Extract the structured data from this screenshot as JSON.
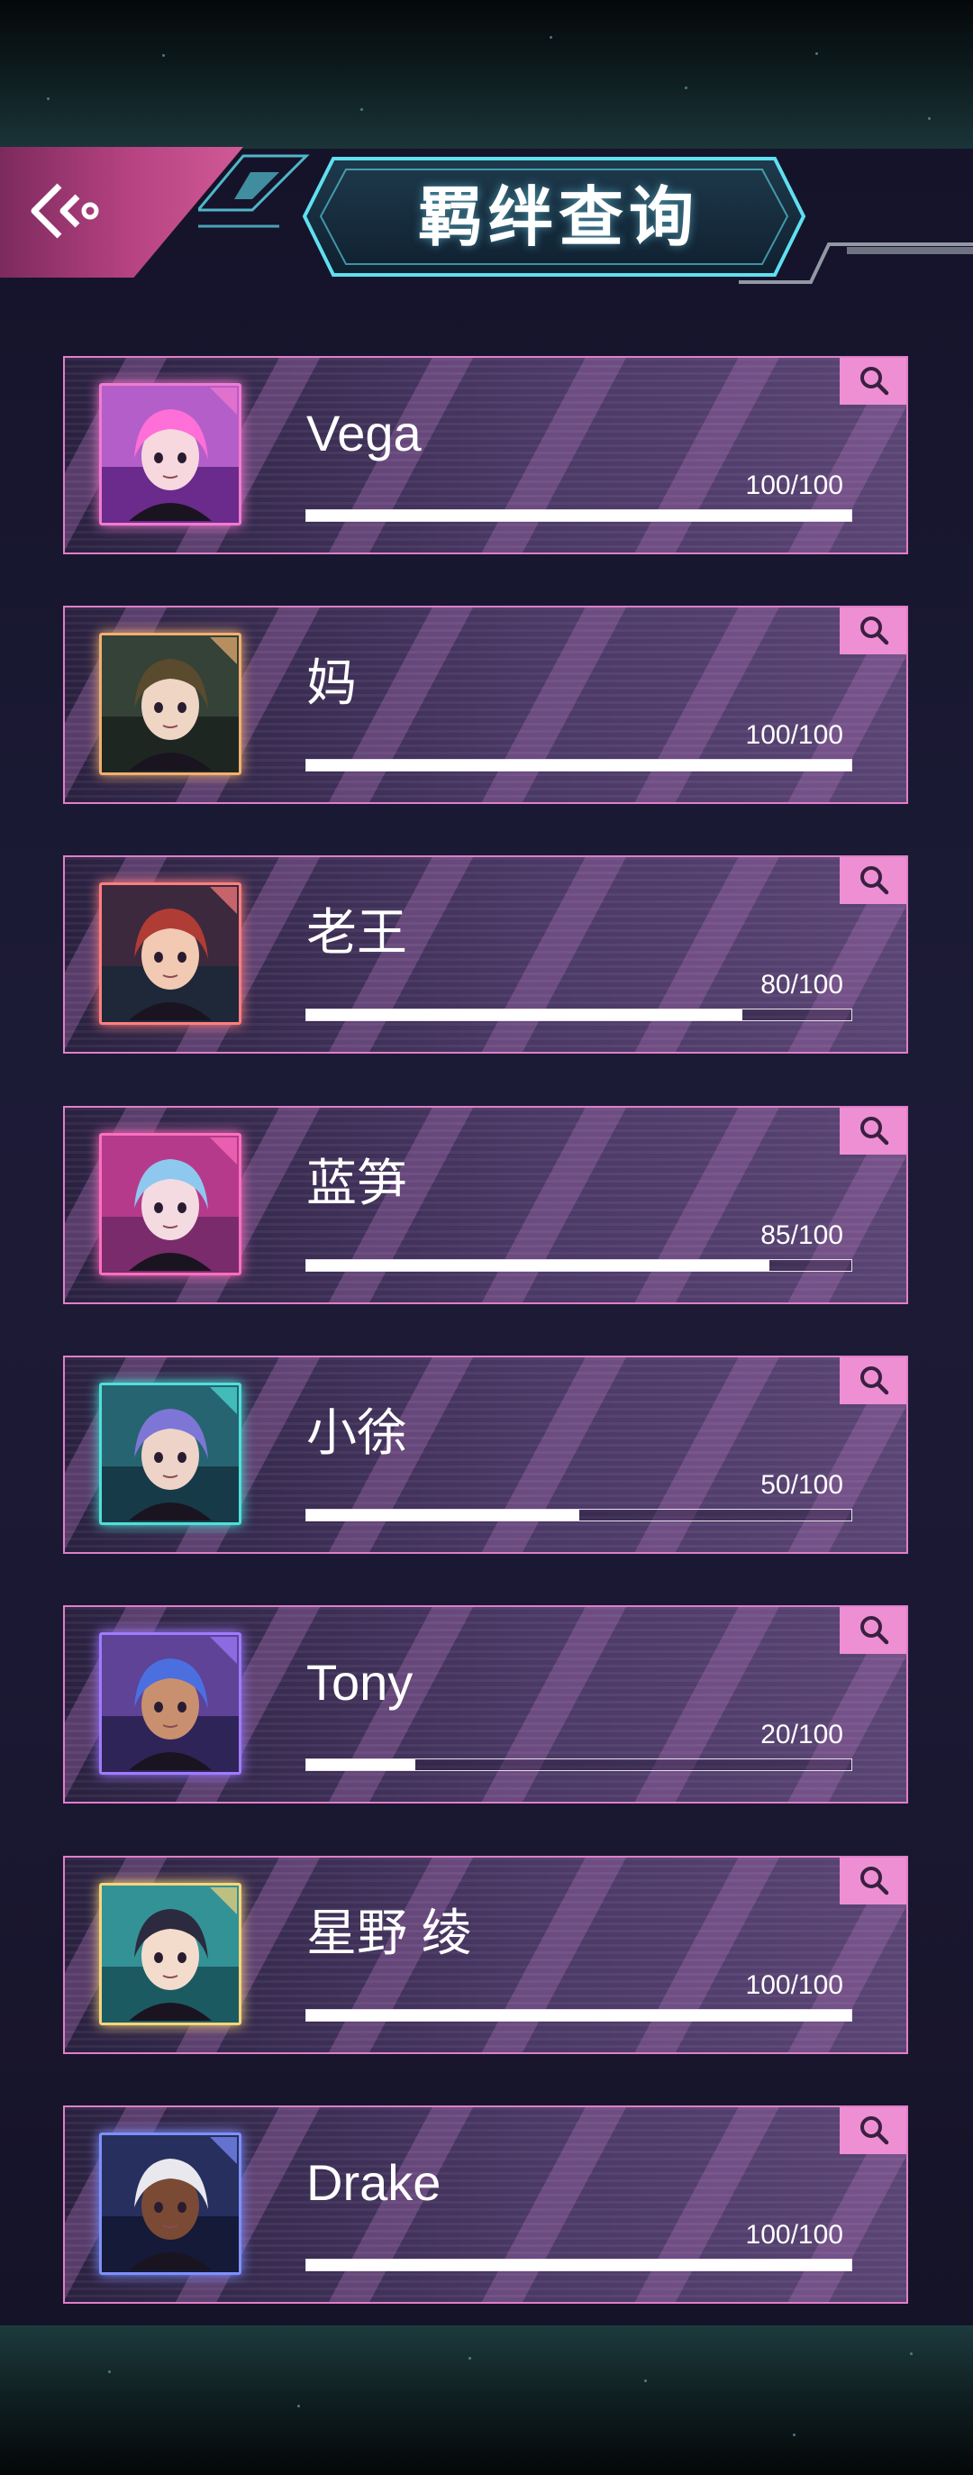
{
  "header": {
    "title": "羁绊查询"
  },
  "icons": {
    "back": "back-arrow-icon",
    "search": "magnifier-icon"
  },
  "colors": {
    "card_border": "#e07fc8",
    "search_button": "#ee8fd4",
    "title_glow": "#5fe0f0",
    "back_button": "#c04b8a"
  },
  "characters": [
    {
      "name": "Vega",
      "score": "100/100",
      "value": 100,
      "max": 100,
      "frame": "#f27ad0",
      "bg1": "#c76bd8",
      "bg2": "#6a2b8c",
      "hair": "#ff6fd8",
      "skin": "#f6d8de"
    },
    {
      "name": "妈",
      "score": "100/100",
      "value": 100,
      "max": 100,
      "frame": "#f0b070",
      "bg1": "#3a4a3e",
      "bg2": "#1e2622",
      "hair": "#5a4a2e",
      "skin": "#efd5c4"
    },
    {
      "name": "老王",
      "score": "80/100",
      "value": 80,
      "max": 100,
      "frame": "#ff7f7f",
      "bg1": "#43293e",
      "bg2": "#1e2838",
      "hair": "#b03c36",
      "skin": "#f2c9b2"
    },
    {
      "name": "蓝笋",
      "score": "85/100",
      "value": 85,
      "max": 100,
      "frame": "#ff6fbf",
      "bg1": "#c53f93",
      "bg2": "#7a2b6c",
      "hair": "#8ec8ee",
      "skin": "#f4dbe2"
    },
    {
      "name": "小徐",
      "score": "50/100",
      "value": 50,
      "max": 100,
      "frame": "#4fe0d8",
      "bg1": "#2c6f7c",
      "bg2": "#173a48",
      "hair": "#7e76d6",
      "skin": "#eed3c8"
    },
    {
      "name": "Tony",
      "score": "20/100",
      "value": 20,
      "max": 100,
      "frame": "#9f7bff",
      "bg1": "#6a4ba8",
      "bg2": "#2e2458",
      "hair": "#4c6fe0",
      "skin": "#c99070"
    },
    {
      "name": "星野 绫",
      "score": "100/100",
      "value": 100,
      "max": 100,
      "frame": "#f6d67a",
      "bg1": "#3aa0a2",
      "bg2": "#1c5a62",
      "hair": "#2c2a3e",
      "skin": "#f4dccc"
    },
    {
      "name": "Drake",
      "score": "100/100",
      "value": 100,
      "max": 100,
      "frame": "#7e90ff",
      "bg1": "#2c3468",
      "bg2": "#141a38",
      "hair": "#e8e8ee",
      "skin": "#7a4a34"
    }
  ]
}
